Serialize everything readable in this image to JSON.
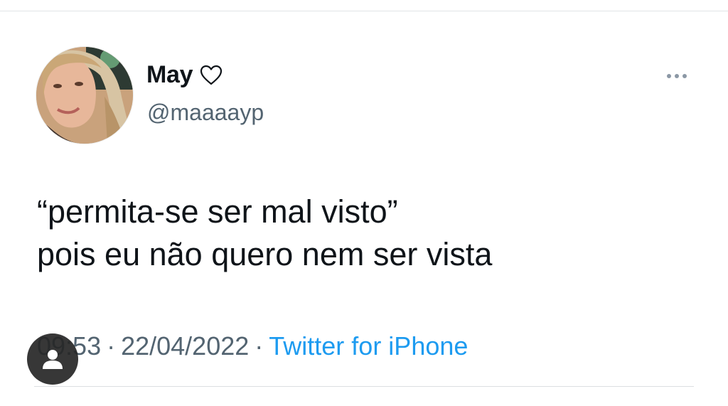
{
  "tweet": {
    "author": {
      "display_name": "May",
      "name_emoji_icon": "heart-outline-icon",
      "handle": "@maaaayp",
      "avatar": "profile-photo"
    },
    "more_icon": "more-horizontal-icon",
    "text_line_1": "“permita-se ser mal visto”",
    "text_line_2": "pois eu não quero nem ser vista",
    "time": "09:53",
    "separator": "·",
    "date": "22/04/2022",
    "source": "Twitter for iPhone"
  },
  "overlay": {
    "profile_button_icon": "person-icon"
  },
  "colors": {
    "text": "#0f1419",
    "secondary": "#536471",
    "link": "#1d9bf0",
    "overlay_button": "#262626"
  }
}
